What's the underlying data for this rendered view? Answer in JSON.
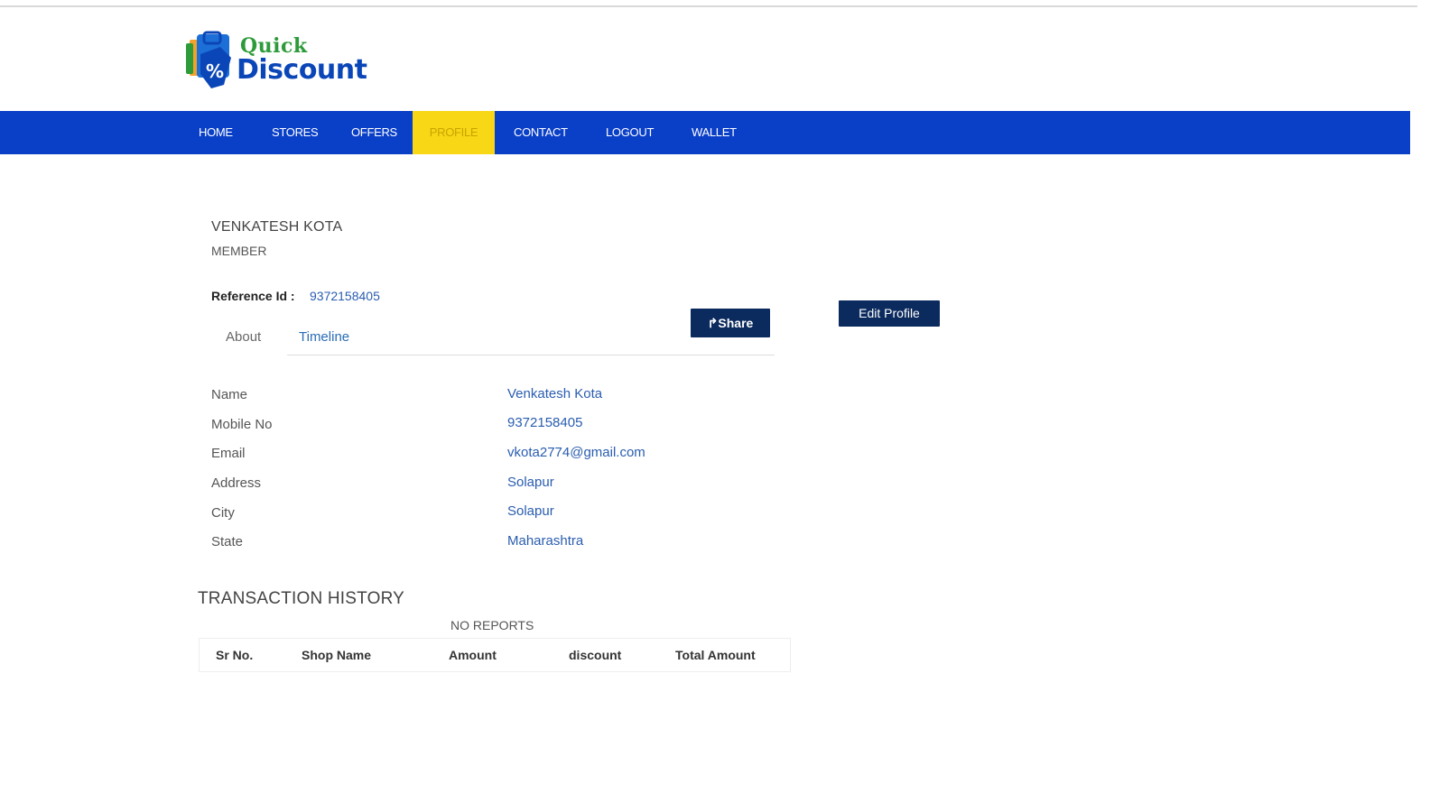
{
  "brand": {
    "line1": "Quick",
    "line2": "Discount",
    "primary_color": "#0a3fc7",
    "accent_color": "#f7d716",
    "button_color": "#0b2a5e",
    "link_color": "#2a5db0"
  },
  "nav": {
    "items": [
      {
        "label": "HOME",
        "active": false
      },
      {
        "label": "STORES",
        "active": false
      },
      {
        "label": "OFFERS",
        "active": false
      },
      {
        "label": "PROFILE",
        "active": true
      },
      {
        "label": "CONTACT",
        "active": false
      },
      {
        "label": "LOGOUT",
        "active": false
      },
      {
        "label": "WALLET",
        "active": false
      }
    ]
  },
  "profile": {
    "name": "VENKATESH KOTA",
    "role": "MEMBER",
    "reference_label": "Reference Id :",
    "reference_value": "9372158405",
    "share_label": "Share",
    "share_icon": "share-arrow-icon",
    "edit_label": "Edit Profile"
  },
  "tabs": [
    {
      "label": "About",
      "active": true
    },
    {
      "label": "Timeline",
      "active": false
    }
  ],
  "fields": [
    {
      "label": "Name",
      "value": "Venkatesh Kota"
    },
    {
      "label": "Mobile No",
      "value": "9372158405"
    },
    {
      "label": "Email",
      "value": "vkota2774@gmail.com"
    },
    {
      "label": "Address",
      "value": "Solapur"
    },
    {
      "label": "City",
      "value": "Solapur"
    },
    {
      "label": "State",
      "value": "Maharashtra"
    }
  ],
  "transactions": {
    "title": "TRANSACTION HISTORY",
    "empty_text": "NO REPORTS",
    "columns": [
      "Sr No.",
      "Shop Name",
      "Amount",
      "discount",
      "Total Amount"
    ]
  }
}
